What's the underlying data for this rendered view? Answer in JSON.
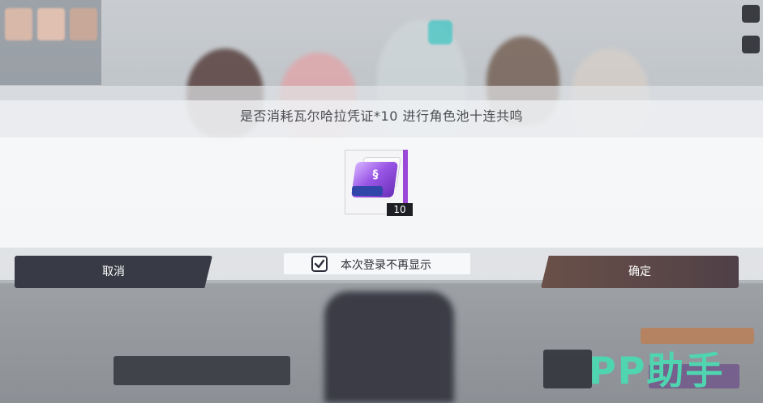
{
  "dialog": {
    "message": "是否消耗瓦尔哈拉凭证*10 进行角色池十连共鸣",
    "item": {
      "icon": "valhalla-voucher-icon",
      "count": "10",
      "rarity_color": "#9b47d8"
    },
    "dont_show_again": {
      "label": "本次登录不再显示",
      "checked": true
    },
    "cancel_label": "取消",
    "confirm_label": "确定"
  },
  "watermark": {
    "text": "PP助手",
    "color": "#4fd5b0"
  },
  "colors": {
    "cancel_button": "#383a45",
    "confirm_button": "#6a5048",
    "accent": "#9b47d8"
  }
}
